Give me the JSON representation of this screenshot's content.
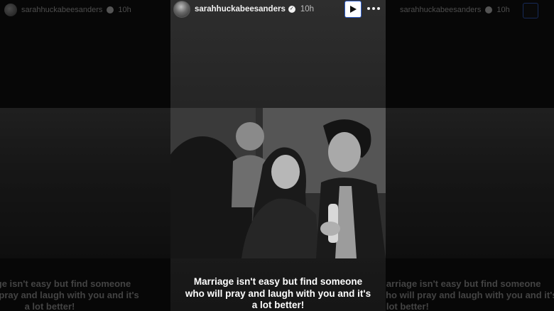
{
  "story": {
    "username": "sarahhuckabeesanders",
    "timestamp": "10h",
    "caption_lines": [
      "Marriage isn't easy but find someone",
      "who will pray and laugh with you and it's",
      "a lot better!"
    ]
  },
  "icons": {
    "verified": "verified-badge-icon",
    "play": "play-icon",
    "more": "more-options-icon"
  },
  "colors": {
    "play_border": "#2f5fd0",
    "background": "#0b0b0b"
  }
}
